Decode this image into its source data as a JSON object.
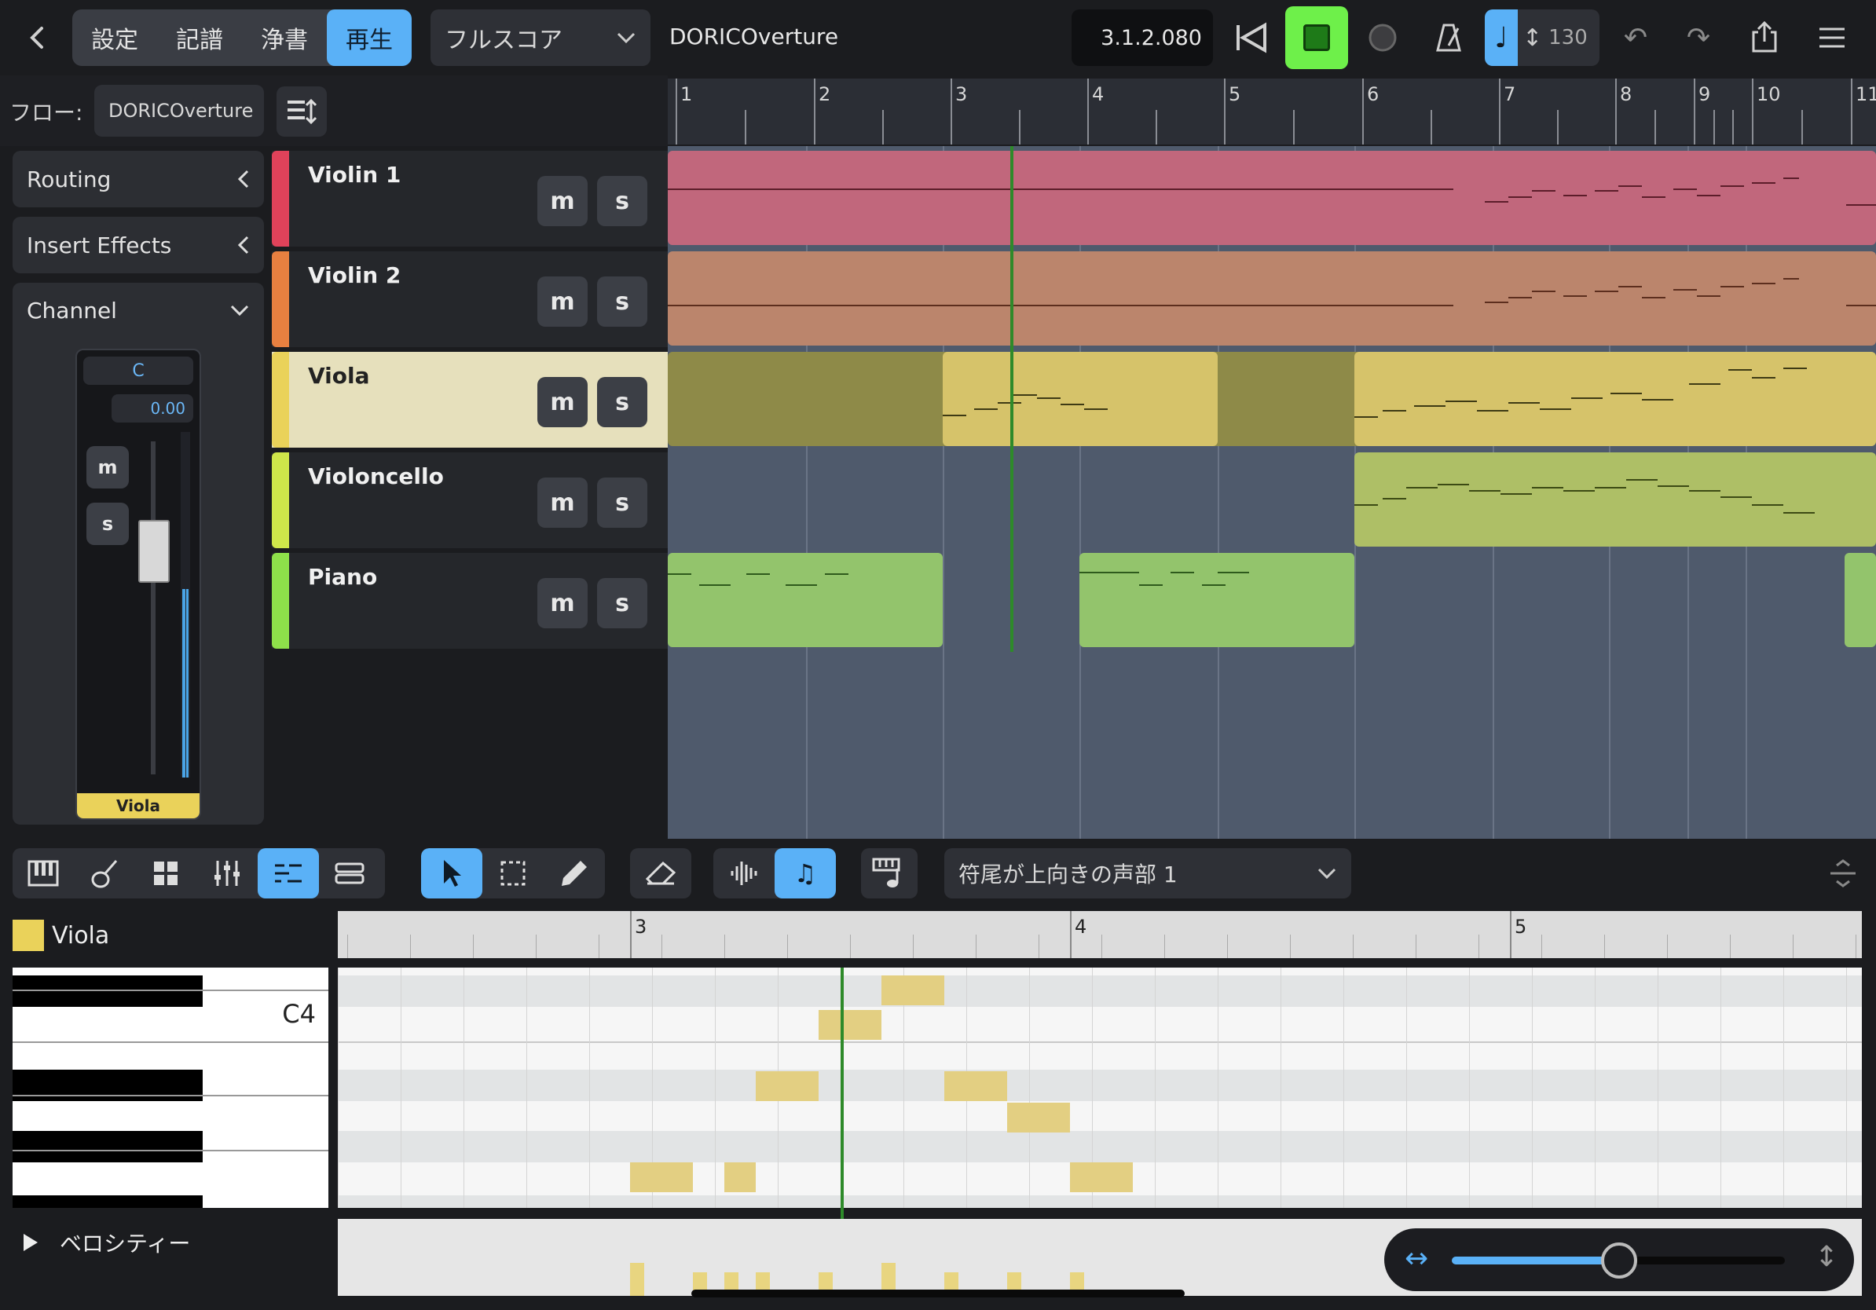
{
  "toolbar": {
    "back_icon": "chevron-left-icon",
    "modes": [
      "設定",
      "記譜",
      "浄書",
      "再生"
    ],
    "active_mode": "再生",
    "layout_select": "フルスコア",
    "project_title": "DORICOverture",
    "timecode": "3.1.2.080",
    "tempo": "130",
    "colors": {
      "accent": "#5ab1f7",
      "stop": "#6ef04a"
    }
  },
  "flow": {
    "label": "フロー:",
    "value": "DORICOverture"
  },
  "ruler": {
    "bars": [
      "1",
      "2",
      "3",
      "4",
      "5",
      "6",
      "7",
      "8",
      "9",
      "10",
      "11"
    ]
  },
  "inspector": {
    "routing": "Routing",
    "insert_effects": "Insert Effects",
    "channel": "Channel",
    "pan": "C",
    "volume": "0.00",
    "mute": "m",
    "solo": "s",
    "channel_name": "Viola"
  },
  "tracks": [
    {
      "name": "Violin 1",
      "color": "#e0425a",
      "mute": "m",
      "solo": "s"
    },
    {
      "name": "Violin 2",
      "color": "#e88040",
      "mute": "m",
      "solo": "s"
    },
    {
      "name": "Viola",
      "color": "#ead25a",
      "mute": "m",
      "solo": "s",
      "selected": true
    },
    {
      "name": "Violoncello",
      "color": "#cfe64a",
      "mute": "m",
      "solo": "s"
    },
    {
      "name": "Piano",
      "color": "#8ee04a",
      "mute": "m",
      "solo": "s"
    }
  ],
  "editor": {
    "voice_select": "符尾が上向きの声部 1",
    "track_name": "Viola",
    "pitch_label": "C4",
    "ruler_bars": [
      "3",
      "4",
      "5"
    ],
    "velocity_label": "ベロシティー"
  }
}
